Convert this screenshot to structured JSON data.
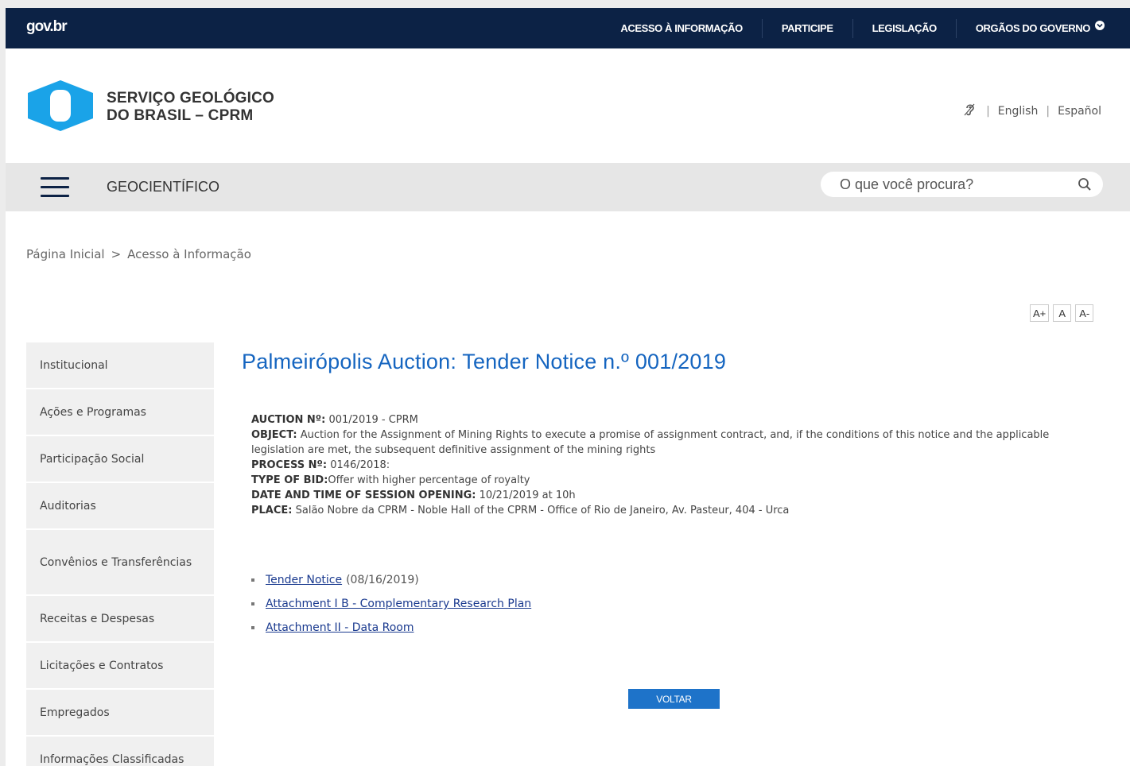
{
  "govbar": {
    "logo": "gov.br",
    "nav": [
      {
        "label": "ACESSO À INFORMAÇÃO"
      },
      {
        "label": "PARTICIPE"
      },
      {
        "label": "LEGISLAÇÃO"
      },
      {
        "label": "ORGÃOS DO GOVERNO"
      }
    ]
  },
  "header": {
    "brand_line1": "SERVIÇO GEOLÓGICO",
    "brand_line2": "DO BRASIL – CPRM",
    "languages": [
      "English",
      "Español"
    ],
    "colors": {
      "logo_blue": "#1aa3e8",
      "govbar": "#0c2245"
    }
  },
  "menubar": {
    "section": "GEOCIENTÍFICO",
    "search_placeholder": "O que você procura?"
  },
  "breadcrumb": {
    "home": "Página Inicial",
    "separator": ">",
    "current": "Acesso à Informação"
  },
  "fontctl": {
    "increase": "A+",
    "normal": "A",
    "decrease": "A-"
  },
  "sidebar": {
    "items": [
      {
        "label": "Institucional"
      },
      {
        "label": "Ações e Programas"
      },
      {
        "label": "Participação Social"
      },
      {
        "label": "Auditorias"
      },
      {
        "label": "Convênios e Transferências"
      },
      {
        "label": "Receitas e Despesas"
      },
      {
        "label": "Licitações e Contratos"
      },
      {
        "label": "Empregados"
      },
      {
        "label": "Informações Classificadas"
      }
    ]
  },
  "content": {
    "title": "Palmeirópolis Auction: Tender Notice n.º 001/2019",
    "details": [
      {
        "label": "AUCTION Nº:",
        "value": " 001/2019 - CPRM"
      },
      {
        "label": "OBJECT:",
        "value": " Auction for the Assignment of Mining Rights to execute a promise of assignment contract, and, if the conditions of this notice and the applicable legislation are met, the subsequent definitive assignment of the mining rights"
      },
      {
        "label": "PROCESS Nº:",
        "value": " 0146/2018:"
      },
      {
        "label": "TYPE OF BID:",
        "value": "Offer with higher percentage of royalty"
      },
      {
        "label": "DATE AND TIME OF SESSION OPENING:",
        "value": " 10/21/2019 at 10h"
      },
      {
        "label": "PLACE:",
        "value": " Salão Nobre da CPRM - Noble Hall of the CPRM - Office of Rio de Janeiro, Av. Pasteur, 404 - Urca"
      }
    ],
    "links": [
      {
        "text": "Tender Notice",
        "note": "(08/16/2019)"
      },
      {
        "text": "Attachment I B - Complementary Research Plan",
        "note": ""
      },
      {
        "text": "Attachment II - Data Room",
        "note": ""
      }
    ],
    "back_button": "VOLTAR"
  }
}
